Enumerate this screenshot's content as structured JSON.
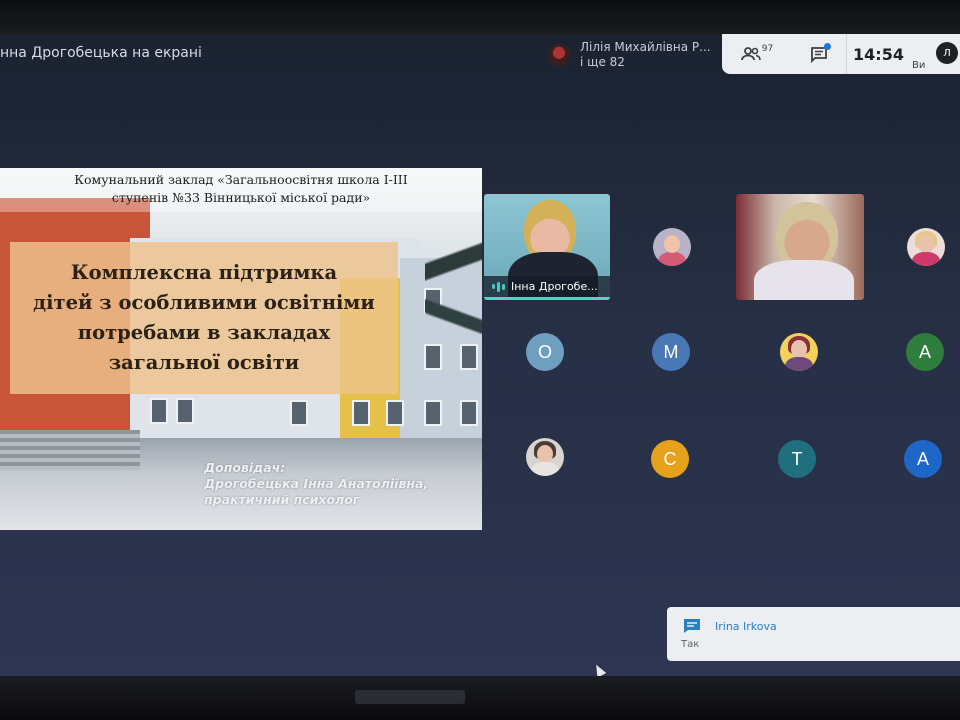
{
  "meeting": {
    "presenting_label": "нна Дрогобецька на екрані",
    "top_participant_name": "Лілія Михайлівна Р...",
    "top_participant_more": "і ще 82",
    "participants_count": "97",
    "time": "14:54",
    "self_label": "Ви",
    "self_avatar_letter": "Л"
  },
  "slide": {
    "header_line1": "Комунальний заклад «Загальноосвітня школа І-ІІІ",
    "header_line2": "ступенів №33 Вінницької міської ради»",
    "title_line1": "Комплексна підтримка",
    "title_line2": "дітей з особливими освітніми",
    "title_line3": "потребами в закладах",
    "title_line4": "загальної освіти",
    "speaker_label": "Доповідач:",
    "speaker_name": "Дрогобецька Інна Анатоліївна,",
    "speaker_role": "практичний психолог"
  },
  "tiles": {
    "active_speaker_name": "Інна Дрогобе...",
    "letters": [
      "О",
      "М",
      "А",
      "С",
      "Т",
      "А"
    ]
  },
  "colors": {
    "av_o": "#6f9fbf",
    "av_m": "#4a78b5",
    "av_a1": "#2f7d3c",
    "av_c": "#e5a21a",
    "av_t": "#1f6f7f",
    "av_a2": "#1e66c7"
  },
  "chat": {
    "sender": "Irina Irkova",
    "message": "Так"
  }
}
